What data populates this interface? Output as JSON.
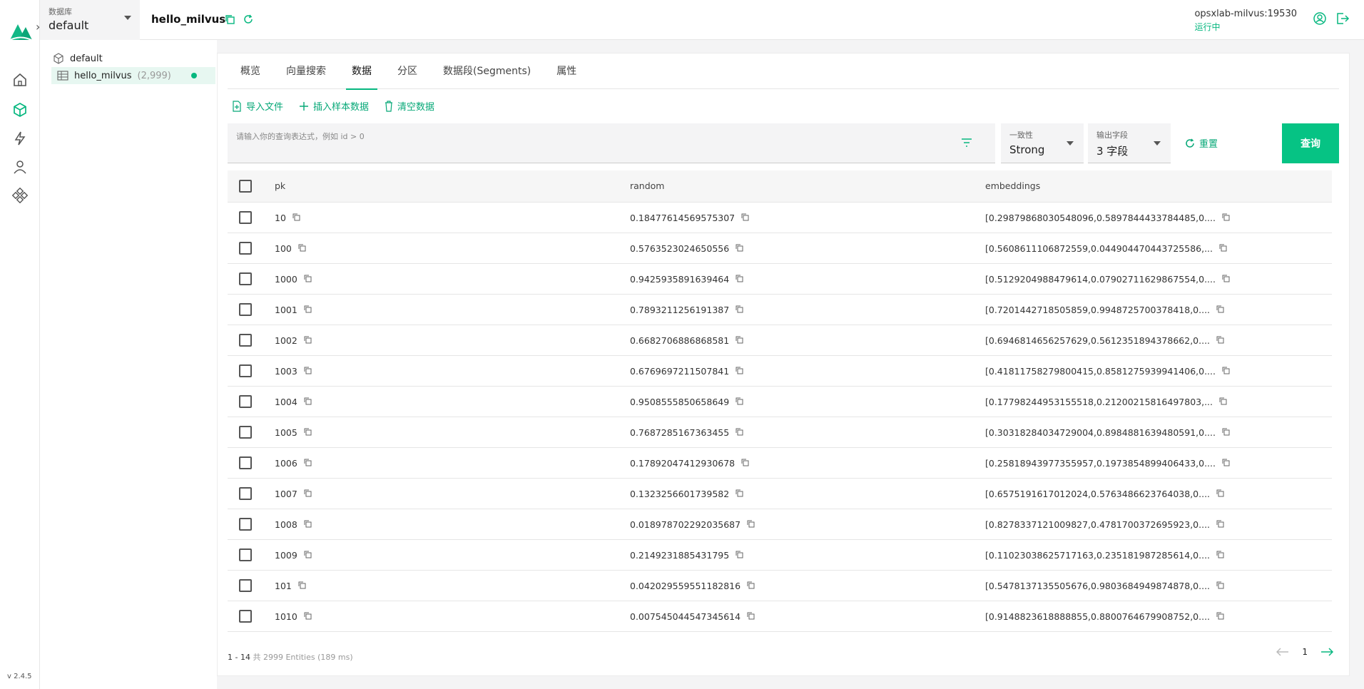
{
  "rail": {
    "version": "v 2.4.5",
    "nav": [
      "home-icon",
      "collection-icon",
      "lightning-icon",
      "user-icon",
      "plugins-icon"
    ]
  },
  "topbar": {
    "db_label": "数据库",
    "db_value": "default",
    "collection": "hello_milvus",
    "server_host": "opsxlab-milvus:19530",
    "server_state": "运行中"
  },
  "tree": {
    "database": "default",
    "collection": "hello_milvus",
    "count": "(2,999)"
  },
  "tabs": [
    "概览",
    "向量搜索",
    "数据",
    "分区",
    "数据段(Segments)",
    "属性"
  ],
  "active_tab": "数据",
  "actions": {
    "import": "导入文件",
    "insert_sample": "插入样本数据",
    "clear": "清空数据"
  },
  "query": {
    "placeholder": "请输入你的查询表达式，例如 id > 0",
    "consistency_label": "一致性",
    "consistency_value": "Strong",
    "output_label": "输出字段",
    "output_value": "3 字段",
    "reset": "重置",
    "submit": "查询"
  },
  "table": {
    "columns": [
      "pk",
      "random",
      "embeddings"
    ],
    "rows": [
      {
        "pk": "10",
        "random": "0.18477614569575307",
        "embeddings": "[0.29879868030548096,0.5897844433784485,0...."
      },
      {
        "pk": "100",
        "random": "0.5763523024650556",
        "embeddings": "[0.5608611106872559,0.044904470443725586,..."
      },
      {
        "pk": "1000",
        "random": "0.9425935891639464",
        "embeddings": "[0.5129204988479614,0.07902711629867554,0...."
      },
      {
        "pk": "1001",
        "random": "0.7893211256191387",
        "embeddings": "[0.7201442718505859,0.9948725700378418,0...."
      },
      {
        "pk": "1002",
        "random": "0.6682706886868581",
        "embeddings": "[0.6946814656257629,0.5612351894378662,0...."
      },
      {
        "pk": "1003",
        "random": "0.6769697211507841",
        "embeddings": "[0.41811758279800415,0.8581275939941406,0...."
      },
      {
        "pk": "1004",
        "random": "0.9508555850658649",
        "embeddings": "[0.17798244953155518,0.21200215816497803,..."
      },
      {
        "pk": "1005",
        "random": "0.7687285167363455",
        "embeddings": "[0.30318284034729004,0.8984881639480591,0...."
      },
      {
        "pk": "1006",
        "random": "0.17892047412930678",
        "embeddings": "[0.25818943977355957,0.1973854899406433,0...."
      },
      {
        "pk": "1007",
        "random": "0.1323256601739582",
        "embeddings": "[0.6575191617012024,0.5763486623764038,0...."
      },
      {
        "pk": "1008",
        "random": "0.018978702292035687",
        "embeddings": "[0.8278337121009827,0.4781700372695923,0...."
      },
      {
        "pk": "1009",
        "random": "0.2149231885431795",
        "embeddings": "[0.11023038625717163,0.235181987285614,0...."
      },
      {
        "pk": "101",
        "random": "0.042029559551182816",
        "embeddings": "[0.5478137135505676,0.9803684949874878,0...."
      },
      {
        "pk": "1010",
        "random": "0.007545044547345614",
        "embeddings": "[0.9148823618888855,0.8800764679908752,0...."
      }
    ]
  },
  "footer": {
    "range": "1 - 14",
    "summary": "共 2999 Entities (189 ms)",
    "page": "1"
  },
  "colors": {
    "accent": "#06c384",
    "accent_text": "#06a877"
  }
}
